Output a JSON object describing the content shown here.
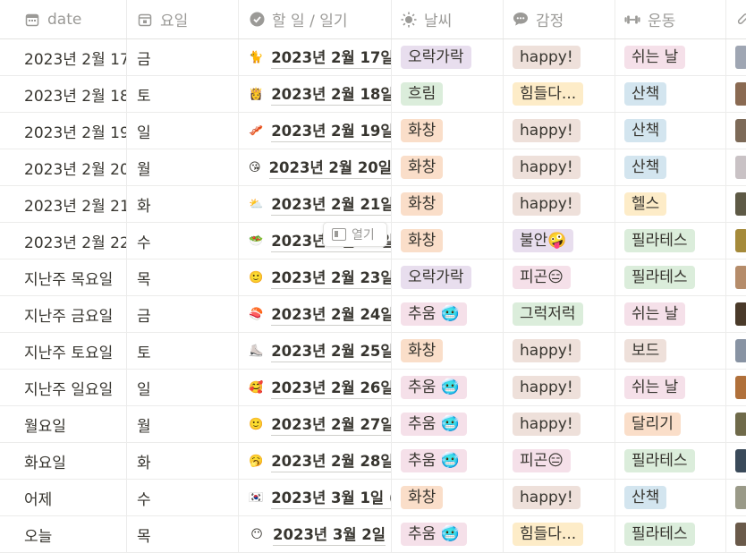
{
  "columns": {
    "date": "date",
    "day": "요일",
    "todo": "할 일 / 일기",
    "weather": "날씨",
    "emotion": "감정",
    "exercise": "운동"
  },
  "open_button": "열기",
  "rows": [
    {
      "date": "2023년 2월 17",
      "day": "금",
      "icon": "🐈",
      "todo": "2023년 2월 17일",
      "weather": {
        "label": "오락가락",
        "color": "purple"
      },
      "emotion": {
        "label": "happy!",
        "color": "brown"
      },
      "exercise": {
        "label": "쉬는 날",
        "color": "pink"
      },
      "photo": "#9fa6b3"
    },
    {
      "date": "2023년 2월 18",
      "day": "토",
      "icon": "👸",
      "todo": "2023년 2월 18일",
      "weather": {
        "label": "흐림",
        "color": "green"
      },
      "emotion": {
        "label": "힘들다...",
        "color": "yellow"
      },
      "exercise": {
        "label": "산책",
        "color": "blue"
      },
      "photo": "#8a6a52"
    },
    {
      "date": "2023년 2월 19",
      "day": "일",
      "icon": "🥓",
      "todo": "2023년 2월 19일",
      "weather": {
        "label": "화창",
        "color": "orange"
      },
      "emotion": {
        "label": "happy!",
        "color": "brown"
      },
      "exercise": {
        "label": "산책",
        "color": "blue"
      },
      "photo": "#7d6a58"
    },
    {
      "date": "2023년 2월 20",
      "day": "월",
      "icon": "😘",
      "todo": "2023년 2월 20일",
      "weather": {
        "label": "화창",
        "color": "orange"
      },
      "emotion": {
        "label": "happy!",
        "color": "brown"
      },
      "exercise": {
        "label": "산책",
        "color": "blue"
      },
      "photo": "#c9c2c5"
    },
    {
      "date": "2023년 2월 21",
      "day": "화",
      "icon": "⛅",
      "todo": "2023년 2월 21일",
      "weather": {
        "label": "화창",
        "color": "orange"
      },
      "emotion": {
        "label": "happy!",
        "color": "brown"
      },
      "exercise": {
        "label": "헬스",
        "color": "yellow"
      },
      "photo": "#5e5a46"
    },
    {
      "date": "2023년 2월 22",
      "day": "수",
      "icon": "🥗",
      "todo": "2023년 2월 22일",
      "weather": {
        "label": "화창",
        "color": "orange"
      },
      "emotion": {
        "label": "불안🤪",
        "color": "purple"
      },
      "exercise": {
        "label": "필라테스",
        "color": "green"
      },
      "photo": "#a58a3a"
    },
    {
      "date": "지난주 목요일",
      "day": "목",
      "icon": "🙂",
      "todo": "2023년 2월 23일",
      "weather": {
        "label": "오락가락",
        "color": "purple"
      },
      "emotion": {
        "label": "피곤😑",
        "color": "pink"
      },
      "exercise": {
        "label": "필라테스",
        "color": "green"
      },
      "photo": "#b58c6a"
    },
    {
      "date": "지난주 금요일",
      "day": "금",
      "icon": "🍣",
      "todo": "2023년 2월 24일",
      "weather": {
        "label": "추움 🥶",
        "color": "pink"
      },
      "emotion": {
        "label": "그럭저럭",
        "color": "green"
      },
      "exercise": {
        "label": "쉬는 날",
        "color": "pink"
      },
      "photo": "#4a3a2a"
    },
    {
      "date": "지난주 토요일",
      "day": "토",
      "icon": "⛸️",
      "todo": "2023년 2월 25일",
      "weather": {
        "label": "화창",
        "color": "orange"
      },
      "emotion": {
        "label": "happy!",
        "color": "brown"
      },
      "exercise": {
        "label": "보드",
        "color": "brown"
      },
      "photo": "#8893a3"
    },
    {
      "date": "지난주 일요일",
      "day": "일",
      "icon": "🥰",
      "todo": "2023년 2월 26일",
      "weather": {
        "label": "추움 🥶",
        "color": "pink"
      },
      "emotion": {
        "label": "happy!",
        "color": "brown"
      },
      "exercise": {
        "label": "쉬는 날",
        "color": "pink"
      },
      "photo": "#b0703a"
    },
    {
      "date": "월요일",
      "day": "월",
      "icon": "🙂",
      "todo": "2023년 2월 27일",
      "weather": {
        "label": "추움 🥶",
        "color": "pink"
      },
      "emotion": {
        "label": "happy!",
        "color": "brown"
      },
      "exercise": {
        "label": "달리기",
        "color": "orange"
      },
      "photo": "#6f6a4a"
    },
    {
      "date": "화요일",
      "day": "화",
      "icon": "🥱",
      "todo": "2023년 2월 28일",
      "weather": {
        "label": "추움 🥶",
        "color": "pink"
      },
      "emotion": {
        "label": "피곤😑",
        "color": "pink"
      },
      "exercise": {
        "label": "필라테스",
        "color": "green"
      },
      "photo": "#3a4a5a"
    },
    {
      "date": "어제",
      "day": "수",
      "icon": "🇰🇷",
      "todo": "2023년 3월 1일 (",
      "weather": {
        "label": "화창",
        "color": "orange"
      },
      "emotion": {
        "label": "happy!",
        "color": "brown"
      },
      "exercise": {
        "label": "산책",
        "color": "blue"
      },
      "photo": "#9a9a88"
    },
    {
      "date": "오늘",
      "day": "목",
      "icon": "😶",
      "todo": "2023년 3월 2일",
      "weather": {
        "label": "추움 🥶",
        "color": "pink"
      },
      "emotion": {
        "label": "힘들다...",
        "color": "yellow"
      },
      "exercise": {
        "label": "필라테스",
        "color": "green"
      },
      "photo": "#6a5a4a"
    }
  ]
}
